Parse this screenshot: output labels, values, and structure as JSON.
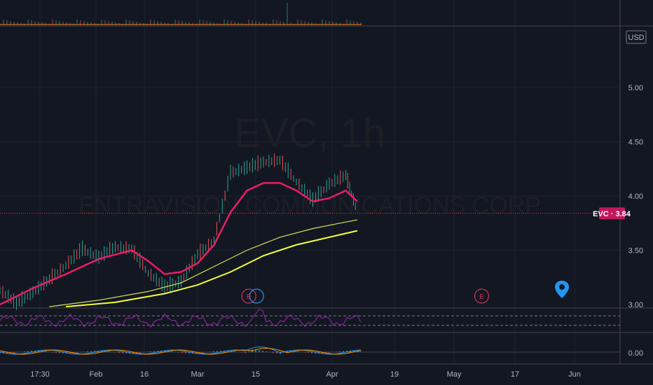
{
  "watermark": {
    "symbol_interval": "EVC, 1h",
    "company": "ENTRAVISION COMMUNICATIONS CORP"
  },
  "price_scale": {
    "currency": "USD",
    "current_label": "EVC · 3.84",
    "colors": {
      "tag": "#c2185b",
      "line": "#e53935"
    }
  },
  "chart_data": {
    "type": "line",
    "symbol": "EVC",
    "interval": "1h",
    "last_price": 3.84,
    "ylim": [
      2.95,
      5.55
    ],
    "y_ticks": [
      "5.00",
      "4.50",
      "4.00",
      "3.50",
      "3.00"
    ],
    "x_ticks": [
      "17:30",
      "Feb",
      "16",
      "Mar",
      "15",
      "Apr",
      "19",
      "May",
      "17",
      "Jun"
    ],
    "price_x": [
      0,
      5,
      10,
      15,
      20,
      25,
      30,
      35,
      40,
      45,
      50,
      55,
      60,
      65,
      70,
      75,
      80,
      85,
      90,
      95,
      100,
      105,
      108.5
    ],
    "price_close": [
      3.12,
      3.0,
      3.1,
      3.22,
      3.35,
      3.5,
      3.42,
      3.52,
      3.5,
      3.28,
      3.15,
      3.2,
      3.45,
      3.58,
      4.2,
      4.25,
      4.3,
      4.32,
      4.12,
      3.95,
      4.1,
      4.18,
      3.84
    ],
    "series": [
      {
        "name": "",
        "x": [
          0,
          10,
          20,
          30,
          40,
          45,
          50,
          55,
          60,
          65,
          70,
          75,
          80,
          85,
          90,
          95,
          100,
          105,
          108.5
        ],
        "values": [
          3.0,
          3.15,
          3.28,
          3.42,
          3.5,
          3.4,
          3.28,
          3.3,
          3.38,
          3.55,
          3.85,
          4.05,
          4.12,
          4.12,
          4.05,
          3.95,
          3.98,
          4.05,
          3.95
        ],
        "color": "#e91e63"
      },
      {
        "name": "",
        "x": [
          15,
          30,
          45,
          55,
          65,
          75,
          85,
          95,
          105,
          108.5
        ],
        "values": [
          2.98,
          3.04,
          3.12,
          3.2,
          3.35,
          3.5,
          3.62,
          3.7,
          3.76,
          3.78
        ],
        "color": "#d4e157"
      },
      {
        "name": "",
        "x": [
          20,
          35,
          50,
          60,
          70,
          80,
          90,
          100,
          108.5
        ],
        "values": [
          2.98,
          3.02,
          3.1,
          3.18,
          3.3,
          3.45,
          3.55,
          3.62,
          3.68
        ],
        "color": "#f2ff3b"
      }
    ],
    "earnings_markers": [
      {
        "label": "E",
        "x": 66
      },
      {
        "label": "E",
        "x": 125
      }
    ],
    "rsi_panel": {
      "color": "#9c27b0",
      "bands": [
        0.3,
        0.7
      ]
    },
    "macd_panel": {
      "tick": "0.00",
      "macd_color": "#2196f3",
      "signal_color": "#ff9800"
    },
    "grid": true
  }
}
